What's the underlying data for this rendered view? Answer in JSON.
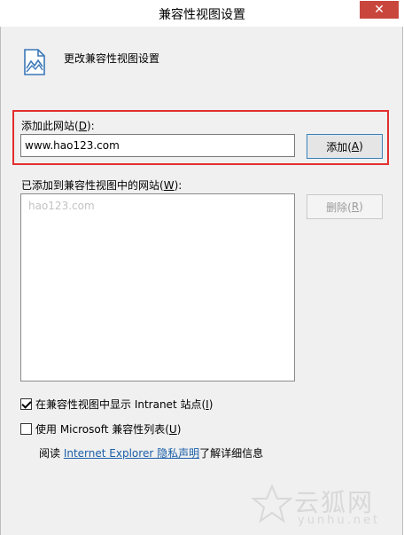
{
  "window": {
    "title": "兼容性视图设置",
    "close_glyph": "✕"
  },
  "header": {
    "text": "更改兼容性视图设置"
  },
  "add_section": {
    "label_prefix": "添加此网站(",
    "label_key": "D",
    "label_suffix": "):",
    "input_value": "www.hao123.com",
    "add_button_prefix": "添加(",
    "add_button_key": "A",
    "add_button_suffix": ")"
  },
  "list_section": {
    "label_prefix": "已添加到兼容性视图中的网站(",
    "label_key": "W",
    "label_suffix": "):",
    "items": [
      "hao123.com"
    ],
    "remove_button_prefix": "删除(",
    "remove_button_key": "R",
    "remove_button_suffix": ")"
  },
  "options": {
    "intranet_prefix": "在兼容性视图中显示 Intranet 站点(",
    "intranet_key": "I",
    "intranet_suffix": ")",
    "intranet_checked": true,
    "ms_list_prefix": "使用 Microsoft 兼容性列表(",
    "ms_list_key": "U",
    "ms_list_suffix": ")",
    "ms_list_checked": false
  },
  "privacy": {
    "read": "阅读 ",
    "link_text": "Internet Explorer 隐私声明",
    "suffix": "了解详细信息"
  },
  "watermark": {
    "main": "云狐网",
    "sub": "yunhu.net"
  },
  "colors": {
    "highlight": "#e32f2f",
    "close_button": "#c9463d",
    "link": "#1a5ea8"
  }
}
